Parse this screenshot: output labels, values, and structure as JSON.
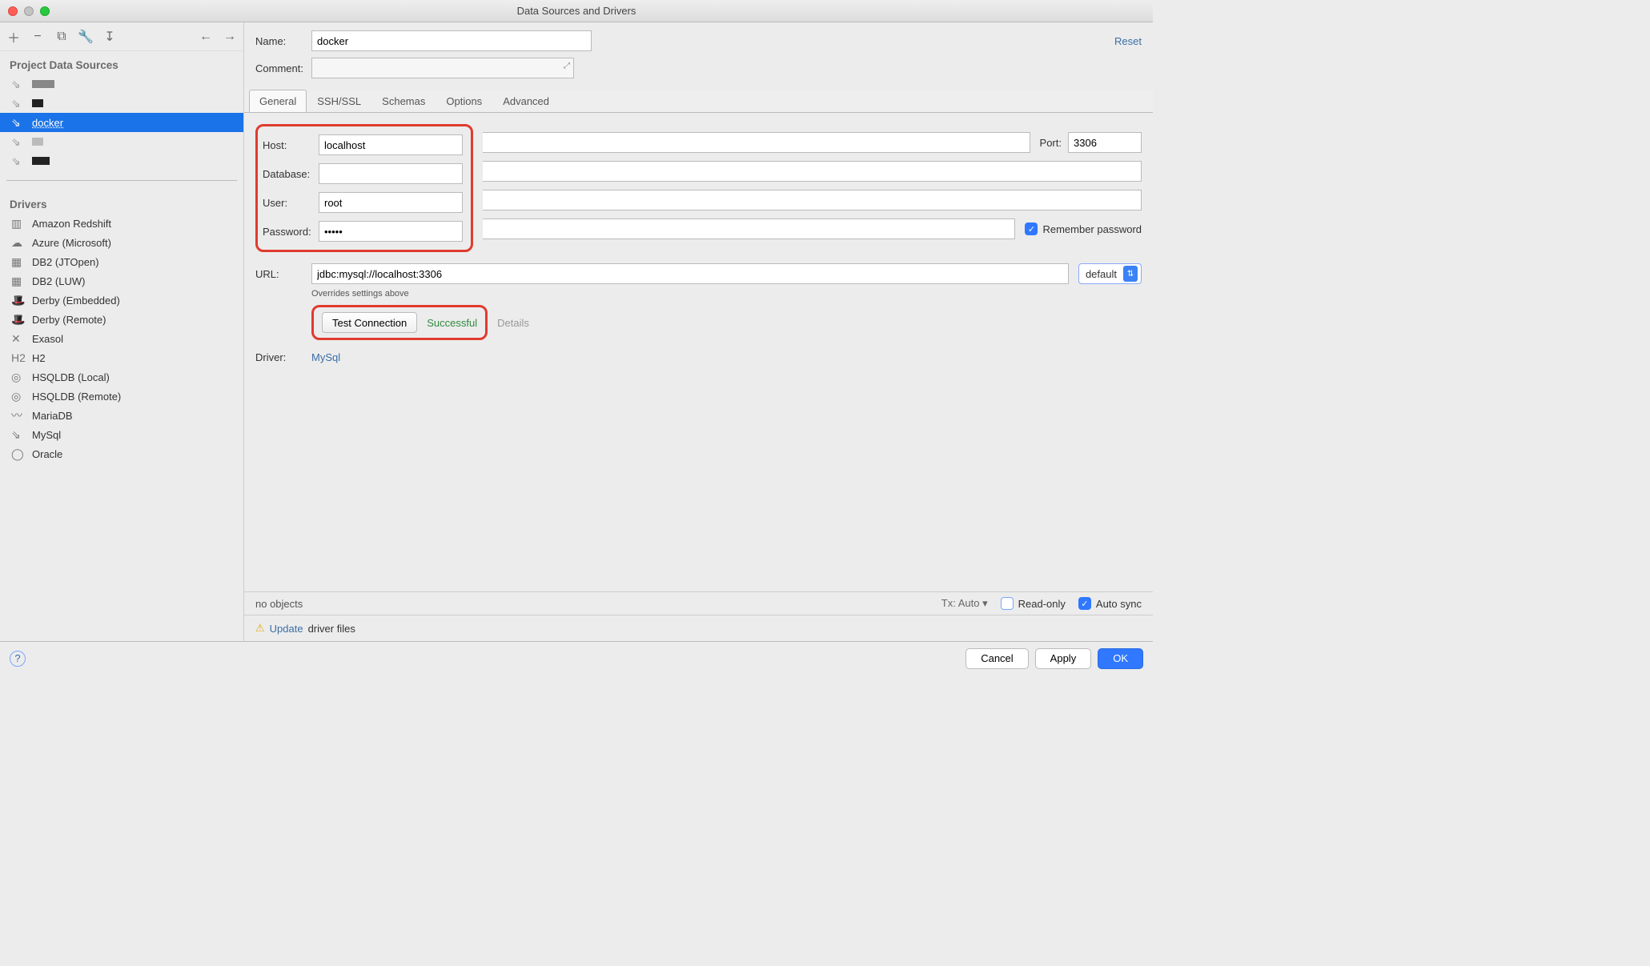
{
  "window": {
    "title": "Data Sources and Drivers"
  },
  "left": {
    "sections": {
      "project": "Project Data Sources",
      "drivers": "Drivers"
    },
    "datasources": [
      {
        "name": "",
        "blob": "g1"
      },
      {
        "name": "",
        "blob": "g2"
      },
      {
        "name": "docker",
        "selected": true
      },
      {
        "name": "",
        "blob": "g3"
      },
      {
        "name": "",
        "blob": "g4"
      }
    ],
    "drivers": [
      "Amazon Redshift",
      "Azure (Microsoft)",
      "DB2 (JTOpen)",
      "DB2 (LUW)",
      "Derby (Embedded)",
      "Derby (Remote)",
      "Exasol",
      "H2",
      "HSQLDB (Local)",
      "HSQLDB (Remote)",
      "MariaDB",
      "MySql",
      "Oracle"
    ]
  },
  "form": {
    "name_label": "Name:",
    "name_value": "docker",
    "comment_label": "Comment:",
    "reset": "Reset",
    "tabs": [
      "General",
      "SSH/SSL",
      "Schemas",
      "Options",
      "Advanced"
    ],
    "active_tab": "General",
    "host_label": "Host:",
    "host_value": "localhost",
    "port_label": "Port:",
    "port_value": "3306",
    "database_label": "Database:",
    "database_value": "",
    "user_label": "User:",
    "user_value": "root",
    "password_label": "Password:",
    "password_value": "•••••",
    "remember_label": "Remember password",
    "url_label": "URL:",
    "url_value": "jdbc:mysql://localhost:3306",
    "url_hint": "Overrides settings above",
    "url_mode": "default",
    "test_btn": "Test Connection",
    "test_status": "Successful",
    "details": "Details",
    "driver_label": "Driver:",
    "driver_value": "MySql"
  },
  "status": {
    "no_objects": "no objects",
    "tx": "Tx: Auto",
    "readonly": "Read-only",
    "autosync": "Auto sync",
    "update_link": "Update",
    "update_rest": " driver files"
  },
  "footer": {
    "cancel": "Cancel",
    "apply": "Apply",
    "ok": "OK"
  }
}
